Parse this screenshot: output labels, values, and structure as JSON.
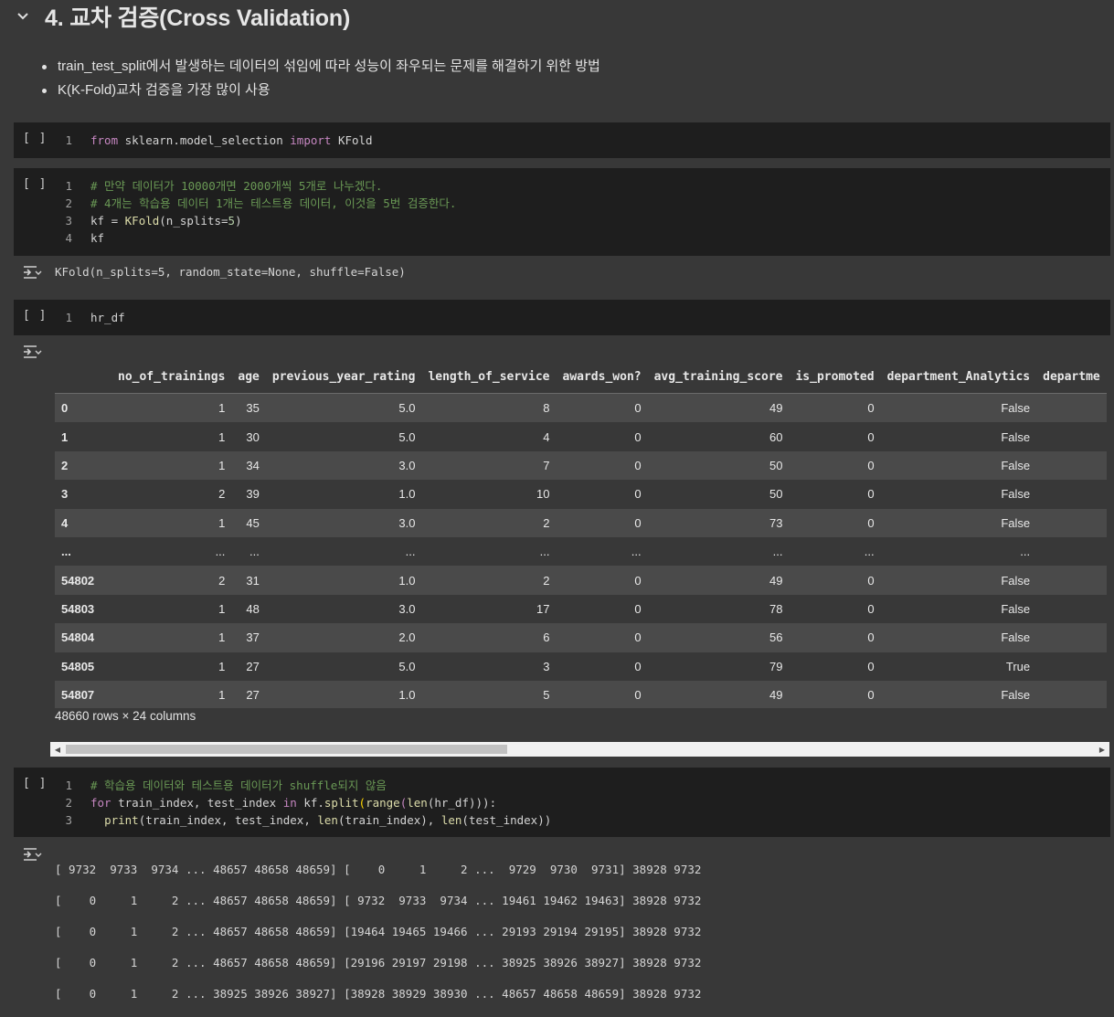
{
  "section": {
    "title": "4. 교차 검증(Cross Validation)"
  },
  "bullets": [
    "train_test_split에서 발생하는 데이터의 섞임에 따라 성능이 좌우되는 문제를 해결하기 위한 방법",
    "K(K-Fold)교차 검증을 가장 많이 사용"
  ],
  "run_label": "[ ]",
  "cells": {
    "c1": {
      "line_numbers": [
        "1"
      ],
      "import_stmt": [
        "from",
        " sklearn.model_selection ",
        "import",
        " KFold"
      ]
    },
    "c2": {
      "line_numbers": [
        "1",
        "2",
        "3",
        "4"
      ],
      "comment1": "# 만약 데이터가 10000개면 2000개씩 5개로 나누겠다.",
      "comment2": "# 4개는 학습용 데이터 1개는 테스트용 데이터, 이것을 5번 검증한다.",
      "line3_a": "kf = ",
      "line3_fn": "KFold",
      "line3_b": "(n_splits=",
      "line3_num": "5",
      "line3_c": ")",
      "line4": "kf",
      "output": "KFold(n_splits=5, random_state=None, shuffle=False)"
    },
    "c3": {
      "line_numbers": [
        "1"
      ],
      "code": "hr_df"
    },
    "c4": {
      "line_numbers": [
        "1",
        "2",
        "3"
      ],
      "comment": "# 학습용 데이터와 테스트용 데이터가 shuffle되지 않음",
      "line2": [
        "for",
        " train_index, test_index ",
        "in",
        " kf.",
        "split",
        "(",
        "range",
        "(",
        "len",
        "(hr_df)))",
        ":"
      ],
      "line3": [
        "print",
        "(train_index, test_index, ",
        "len",
        "(train_index), ",
        "len",
        "(test_index))"
      ],
      "output_lines": [
        "[ 9732  9733  9734 ... 48657 48658 48659] [    0     1     2 ...  9729  9730  9731] 38928 9732",
        "[    0     1     2 ... 48657 48658 48659] [ 9732  9733  9734 ... 19461 19462 19463] 38928 9732",
        "[    0     1     2 ... 48657 48658 48659] [19464 19465 19466 ... 29193 29194 29195] 38928 9732",
        "[    0     1     2 ... 48657 48658 48659] [29196 29197 29198 ... 38925 38926 38927] 38928 9732",
        "[    0     1     2 ... 38925 38926 38927] [38928 38929 38930 ... 48657 48658 48659] 38928 9732"
      ]
    }
  },
  "dataframe": {
    "columns": [
      "",
      "no_of_trainings",
      "age",
      "previous_year_rating",
      "length_of_service",
      "awards_won?",
      "avg_training_score",
      "is_promoted",
      "department_Analytics",
      "departme"
    ],
    "rows": [
      [
        "0",
        "1",
        "35",
        "5.0",
        "8",
        "0",
        "49",
        "0",
        "False",
        ""
      ],
      [
        "1",
        "1",
        "30",
        "5.0",
        "4",
        "0",
        "60",
        "0",
        "False",
        ""
      ],
      [
        "2",
        "1",
        "34",
        "3.0",
        "7",
        "0",
        "50",
        "0",
        "False",
        ""
      ],
      [
        "3",
        "2",
        "39",
        "1.0",
        "10",
        "0",
        "50",
        "0",
        "False",
        ""
      ],
      [
        "4",
        "1",
        "45",
        "3.0",
        "2",
        "0",
        "73",
        "0",
        "False",
        ""
      ],
      [
        "...",
        "...",
        "...",
        "...",
        "...",
        "...",
        "...",
        "...",
        "...",
        ""
      ],
      [
        "54802",
        "2",
        "31",
        "1.0",
        "2",
        "0",
        "49",
        "0",
        "False",
        ""
      ],
      [
        "54803",
        "1",
        "48",
        "3.0",
        "17",
        "0",
        "78",
        "0",
        "False",
        ""
      ],
      [
        "54804",
        "1",
        "37",
        "2.0",
        "6",
        "0",
        "56",
        "0",
        "False",
        ""
      ],
      [
        "54805",
        "1",
        "27",
        "5.0",
        "3",
        "0",
        "79",
        "0",
        "True",
        ""
      ],
      [
        "54807",
        "1",
        "27",
        "1.0",
        "5",
        "0",
        "49",
        "0",
        "False",
        ""
      ]
    ],
    "shape_info": "48660 rows × 24 columns"
  },
  "icons": {
    "collapse": "chevron-down-icon",
    "output": "output-toggle-icon"
  }
}
